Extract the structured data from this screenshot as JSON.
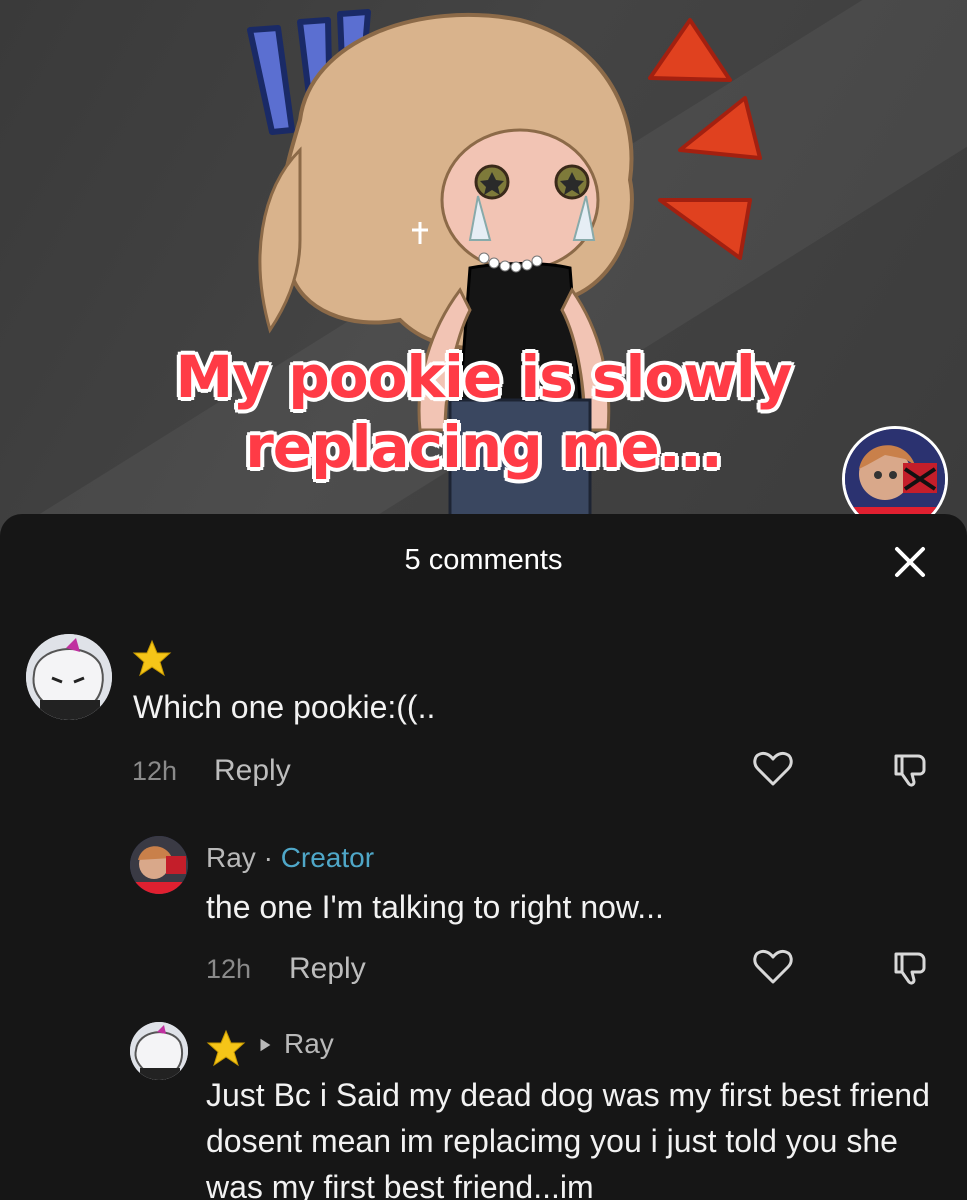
{
  "video": {
    "caption_line1": "My pookie is slowly",
    "caption_line2": "replacing me..."
  },
  "comments_panel": {
    "count_label": "5 comments",
    "comments": [
      {
        "badge": "star-icon",
        "text": "Which one pookie:((..",
        "time": "12h",
        "reply_label": "Reply"
      }
    ],
    "replies": [
      {
        "username": "Ray",
        "separator": " · ",
        "role": "Creator",
        "text": "the one I'm talking to right now...",
        "time": "12h",
        "reply_label": "Reply"
      },
      {
        "badge": "star-icon",
        "reply_to": "Ray",
        "text": "Just Bc i Said my dead dog was my first best friend dosent mean im replacimg you i just told you she was my first best friend...im"
      }
    ]
  },
  "colors": {
    "background": "#161616",
    "caption": "#ff3b46",
    "creator_tag": "#4fa7c8",
    "star": "#f5c518"
  }
}
